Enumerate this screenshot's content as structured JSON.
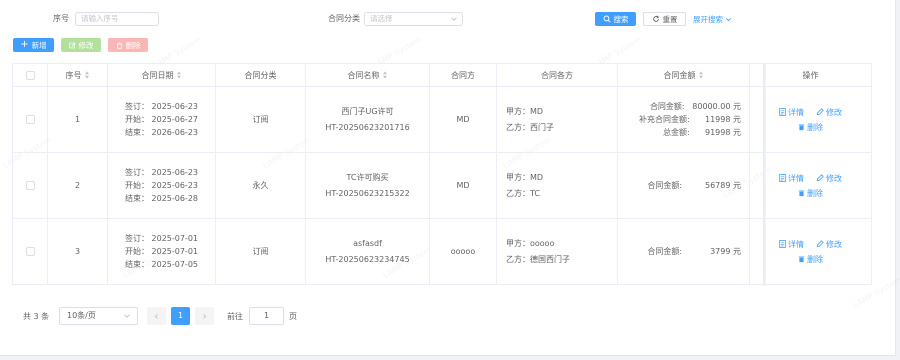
{
  "filters": {
    "seq_label": "序号",
    "seq_placeholder": "请输入序号",
    "category_label": "合同分类",
    "category_placeholder": "请选择",
    "search_label": "搜索",
    "reset_label": "重置",
    "expand_label": "展开搜索"
  },
  "toolbar": {
    "add_label": "新增",
    "edit_label": "修改",
    "delete_label": "删除"
  },
  "table": {
    "headers": [
      "序号",
      "合同日期",
      "合同分类",
      "合同名称",
      "合同方",
      "合同各方",
      "合同金额",
      "操作"
    ],
    "rows": [
      {
        "seq": "1",
        "signed": "签订：  2025-06-23",
        "start": "开始：  2025-06-27",
        "end": "结束：  2026-06-23",
        "category": "订阅",
        "name": "西门子UG许可",
        "code": "HT-20250623201716",
        "party": "MD",
        "party_a": "甲方：MD",
        "party_b": "乙方：西门子",
        "amounts": [
          {
            "label": "合同金额:",
            "value": "80000.00 元"
          },
          {
            "label": "补充合同金额:",
            "value": "11998 元"
          },
          {
            "label": "总金额:",
            "value": "91998 元"
          }
        ]
      },
      {
        "seq": "2",
        "signed": "签订：  2025-06-23",
        "start": "开始：  2025-06-23",
        "end": "结束：  2025-06-28",
        "category": "永久",
        "name": "TC许可购买",
        "code": "HT-20250623215322",
        "party": "MD",
        "party_a": "甲方：MD",
        "party_b": "乙方：TC",
        "amounts": [
          {
            "label": "合同金额:",
            "value": "56789 元"
          }
        ]
      },
      {
        "seq": "3",
        "signed": "签订：  2025-07-01",
        "start": "开始：  2025-07-01",
        "end": "结束：  2025-07-05",
        "category": "订阅",
        "name": "asfasdf",
        "code": "HT-20250623234745",
        "party": "ooooo",
        "party_a": "甲方：ooooo",
        "party_b": "乙方：德国西门子",
        "amounts": [
          {
            "label": "合同金额:",
            "value": "3799 元"
          }
        ]
      }
    ],
    "ops": {
      "detail": "详情",
      "edit": "修改",
      "delete": "删除"
    }
  },
  "pagination": {
    "total": "共 3 条",
    "page_size": "10条/页",
    "current_page": "1",
    "goto_label": "前往",
    "goto_value": "1",
    "page_unit": "页"
  },
  "watermark": "LAMP System",
  "colors": {
    "primary": "#409eff",
    "success_disabled": "#b3e19d",
    "danger_disabled": "#fab6b6"
  }
}
